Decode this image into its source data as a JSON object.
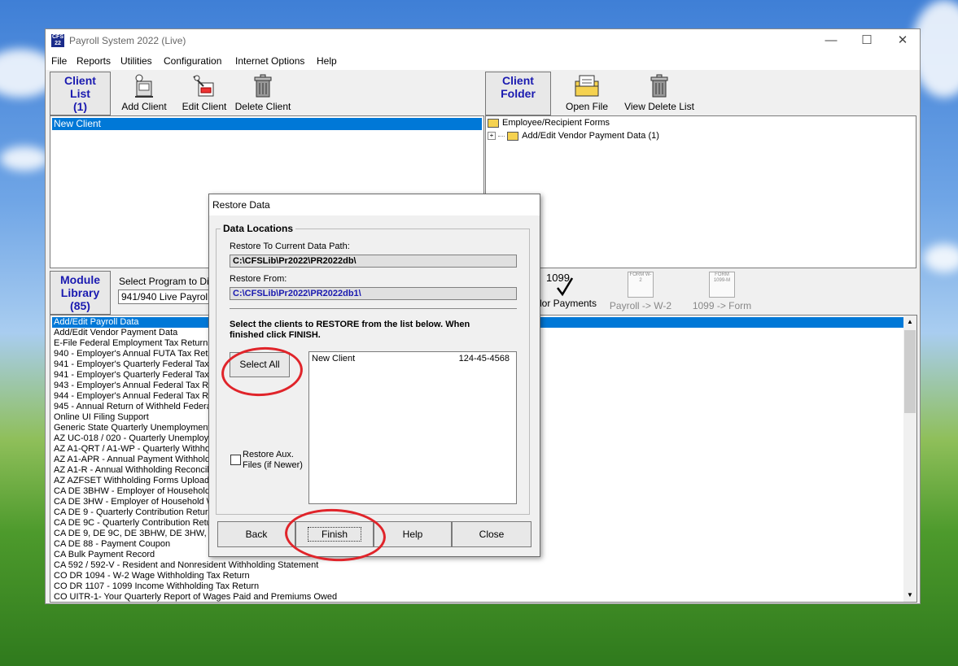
{
  "window": {
    "title": "Payroll System 2022 (Live)",
    "icon_text": "CFS 22",
    "controls": [
      "minimize",
      "maximize",
      "close"
    ]
  },
  "menu": [
    "File",
    "Reports",
    "Utilities",
    "Configuration",
    "Internet Options",
    "Help"
  ],
  "client_panel": {
    "title_line1": "Client",
    "title_line2": "List",
    "title_line3": "(1)",
    "buttons": {
      "add": "Add Client",
      "edit": "Edit Client",
      "delete": "Delete Client"
    },
    "clients": [
      "New Client"
    ]
  },
  "folder_panel": {
    "title_line1": "Client",
    "title_line2": "Folder",
    "buttons": {
      "open": "Open File",
      "view_delete": "View Delete List"
    },
    "tree": {
      "root": "Employee/Recipient Forms",
      "child": "Add/Edit Vendor Payment Data  (1)"
    }
  },
  "module_panel": {
    "title_line1": "Module",
    "title_line2": "Library",
    "title_line3": "(85)",
    "select_label": "Select Program to Displa",
    "select_value": "941/940 Live Payroll",
    "right_buttons": {
      "vendor_payments": "dor Payments",
      "vendor_icon_text": "1099",
      "payroll_w2": "Payroll -> W-2",
      "w2_icon_text": "FORM W-2",
      "form_1099": "1099 -> Form",
      "form1099_icon_text": "FORM 1099-M"
    },
    "modules": [
      "Add/Edit Payroll Data",
      "Add/Edit Vendor Payment Data",
      "E-File Federal Employment Tax Returns",
      "940 - Employer's Annual FUTA Tax Retur",
      "941 - Employer's Quarterly Federal Tax Re",
      "941 - Employer's Quarterly Federal Tax Re",
      "943 - Employer's Annual Federal Tax Ret",
      "944 - Employer's Annual Federal Tax Retu",
      "945 - Annual Return of Withheld Federal I",
      "Online UI Filing Support",
      "Generic State Quarterly Unemployment C",
      "AZ UC-018 / 020 - Quarterly Unemployme",
      "AZ A1-QRT / A1-WP - Quarterly Withhold",
      "AZ A1-APR - Annual Payment Withholdin",
      "AZ A1-R - Annual Withholding Reconcilia",
      "AZ AZFSET Withholding Forms Upload",
      "CA DE 3BHW - Employer of Household W",
      "CA DE 3HW - Employer of Household We",
      "CA DE 9 - Quarterly Contribution Return a",
      "CA DE 9C - Quarterly Contribution Return",
      "CA DE 9, DE 9C, DE 3BHW, DE 3HW, B",
      "CA DE 88 - Payment Coupon",
      "CA Bulk Payment Record",
      "CA 592 / 592-V - Resident and Nonresident Withholding Statement",
      "CO DR 1094 - W-2 Wage Withholding Tax Return",
      "CO DR 1107 - 1099 Income Withholding Tax Return",
      "CO UITR-1- Your Quarterly Report of Wages Paid and Premiums Owed"
    ]
  },
  "dialog": {
    "title": "Restore Data",
    "group_label": "Data Locations",
    "restore_to_label": "Restore To Current Data Path:",
    "restore_to_value": "C:\\CFSLib\\Pr2022\\PR2022db\\",
    "restore_from_label": "Restore From:",
    "restore_from_value": "C:\\CFSLib\\Pr2022\\PR2022db1\\",
    "instruction_line1": "Select the clients to RESTORE from the list below.  When",
    "instruction_line2": "finished click FINISH.",
    "select_all_label": "Select All",
    "aux_label_line1": "Restore Aux.",
    "aux_label_line2": "Files (if Newer)",
    "aux_checked": false,
    "clients": [
      {
        "name": "New Client",
        "id": "124-45-4568"
      }
    ],
    "buttons": {
      "back": "Back",
      "finish": "Finish",
      "help": "Help",
      "close": "Close"
    }
  },
  "colors": {
    "panel_title": "#1a1ab0",
    "selection": "#0078d7",
    "annotation": "#e0242a",
    "path_from": "#1a1ab0"
  }
}
